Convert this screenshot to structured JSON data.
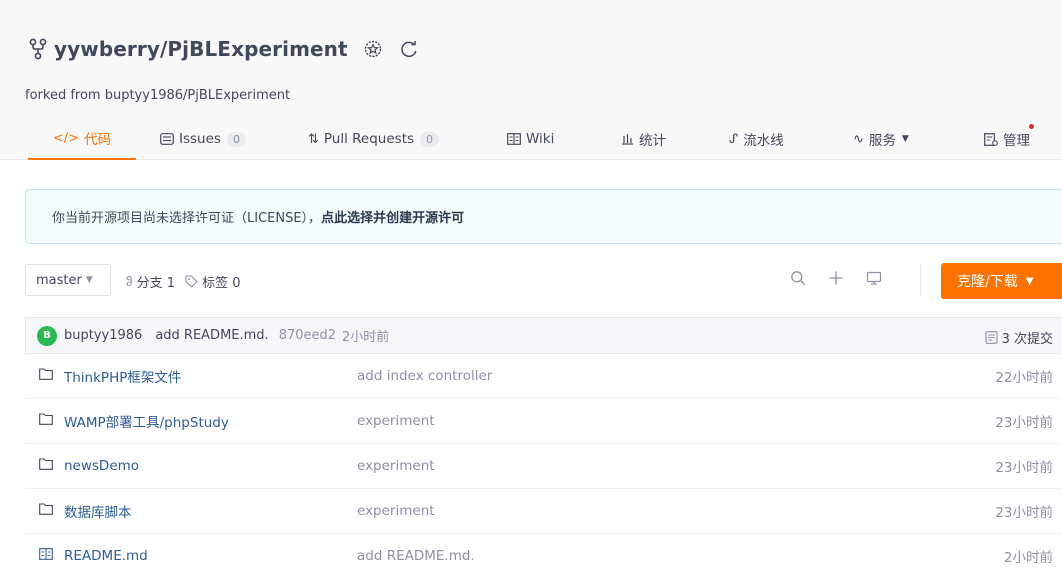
{
  "repo": {
    "title": "yywberry/PjBLExperiment",
    "forked_prefix": "forked from ",
    "forked_source": "buptyy1986/PjBLExperiment"
  },
  "tabs": [
    {
      "label": "代码",
      "icon": "code-icon",
      "active": true
    },
    {
      "label": "Issues",
      "icon": "issues-icon",
      "count": "0"
    },
    {
      "label": "Pull Requests",
      "icon": "pull-request-icon",
      "count": "0"
    },
    {
      "label": "Wiki",
      "icon": "wiki-icon"
    },
    {
      "label": "统计",
      "icon": "stats-icon"
    },
    {
      "label": "流水线",
      "icon": "pipeline-icon"
    },
    {
      "label": "服务",
      "icon": "service-icon",
      "dropdown": true
    },
    {
      "label": "管理",
      "icon": "manage-icon",
      "notification_dot": true
    }
  ],
  "notice": {
    "text": "你当前开源项目尚未选择许可证（LICENSE），",
    "link": "点此选择并创建开源许可"
  },
  "toolbar": {
    "branch": "master",
    "branches_label": "分支 1",
    "tags_label": "标签 0",
    "clone_label": "克隆/下载"
  },
  "commit": {
    "avatar_letter": "B",
    "user": "buptyy1986",
    "message": "add README.md.",
    "hash": "870eed2",
    "time": "2小时前",
    "count_label": "3 次提交"
  },
  "files": [
    {
      "name": "ThinkPHP框架文件",
      "type": "folder",
      "message": "add index controller",
      "time": "22小时前"
    },
    {
      "name": "WAMP部署工具/phpStudy",
      "type": "folder",
      "message": "experiment",
      "time": "23小时前"
    },
    {
      "name": "newsDemo",
      "type": "folder",
      "message": "experiment",
      "time": "23小时前"
    },
    {
      "name": "数据库脚本",
      "type": "folder",
      "message": "experiment",
      "time": "23小时前"
    },
    {
      "name": "README.md",
      "type": "file",
      "message": "add README.md.",
      "time": "2小时前"
    }
  ],
  "colors": {
    "accent": "#fe7300",
    "link": "#2c5c9a",
    "avatar": "#2ab853"
  }
}
